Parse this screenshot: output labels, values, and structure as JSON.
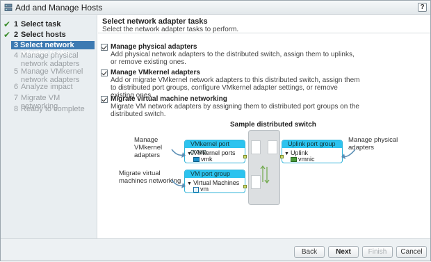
{
  "window": {
    "title": "Add and Manage Hosts",
    "help_label": "?"
  },
  "steps": [
    {
      "num": "1",
      "label": "Select task",
      "state": "done"
    },
    {
      "num": "2",
      "label": "Select hosts",
      "state": "done"
    },
    {
      "num": "3",
      "label": "Select network adapter tasks",
      "state": "current"
    },
    {
      "num": "4",
      "label": "Manage physical network adapters",
      "state": "future"
    },
    {
      "num": "5",
      "label": "Manage VMkernel network adapters",
      "state": "future"
    },
    {
      "num": "6",
      "label": "Analyze impact",
      "state": "future"
    },
    {
      "num": "7",
      "label": "Migrate VM networking",
      "state": "future"
    },
    {
      "num": "8",
      "label": "Ready to complete",
      "state": "future"
    }
  ],
  "header": {
    "title": "Select network adapter tasks",
    "subtitle": "Select the network adapter tasks to perform."
  },
  "options": [
    {
      "title": "Manage physical adapters",
      "desc": "Add physical network adapters to the distributed switch, assign them to uplinks, or remove existing ones.",
      "checked": true
    },
    {
      "title": "Manage VMkernel adapters",
      "desc": "Add or migrate VMkernel network adapters to this distributed switch, assign them to distributed port groups, configure VMkernel adapter settings, or remove existing ones.",
      "checked": true
    },
    {
      "title": "Migrate virtual machine networking",
      "desc": "Migrate VM network adapters by assigning them to distributed port groups on the distributed switch.",
      "checked": true
    }
  ],
  "diagram": {
    "title": "Sample distributed switch",
    "label_manage_vmkernel": "Manage VMkernel adapters",
    "label_migrate_vm": "Migrate virtual machines networking",
    "label_manage_physical": "Manage physical adapters",
    "vmkernel_group": {
      "name": "VMkernel port group",
      "sub": "VMkernel ports",
      "item": "vmk"
    },
    "vm_group": {
      "name": "VM port group",
      "sub": "Virtual Machines",
      "item": "vm"
    },
    "uplink_group": {
      "name": "Uplink port group",
      "sub": "Uplink",
      "item": "vmnic"
    }
  },
  "footer": {
    "back": "Back",
    "next": "Next",
    "finish": "Finish",
    "cancel": "Cancel"
  },
  "colors": {
    "accent": "#3d7ab2",
    "portgroup": "#2cc3ef",
    "check": "#3a8c2c"
  }
}
